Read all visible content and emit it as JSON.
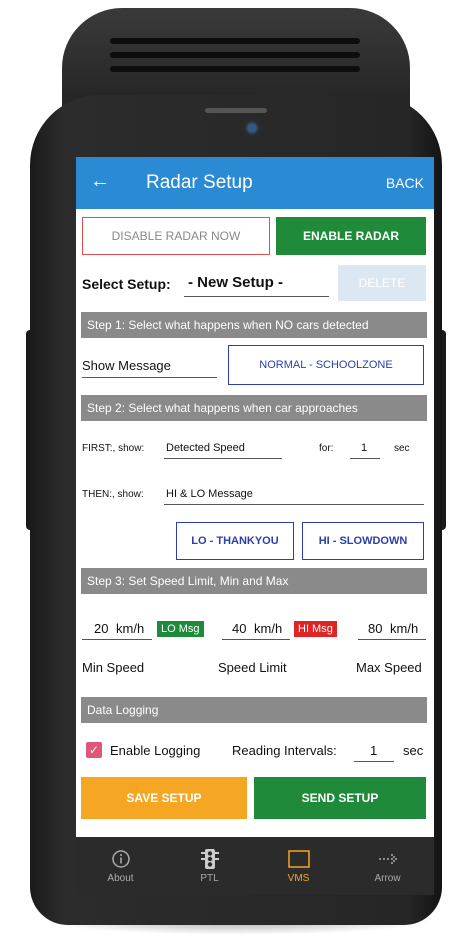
{
  "appbar": {
    "title": "Radar Setup",
    "back_label": "BACK"
  },
  "radar_buttons": {
    "disable_label": "DISABLE RADAR NOW",
    "enable_label": "ENABLE RADAR"
  },
  "setup": {
    "select_label": "Select Setup:",
    "value": "- New Setup -",
    "delete_label": "DELETE"
  },
  "step1": {
    "header": "Step 1: Select what happens when NO cars detected",
    "action_value": "Show Message",
    "message_button": "NORMAL - SCHOOLZONE"
  },
  "step2": {
    "header": "Step 2: Select what happens when car approaches",
    "first_label": "FIRST:, show:",
    "first_value": "Detected Speed",
    "for_label": "for:",
    "for_value": "1",
    "sec_label": "sec",
    "then_label": "THEN:, show:",
    "then_value": "HI & LO Message",
    "lo_button": "LO - THANKYOU",
    "hi_button": "HI - SLOWDOWN"
  },
  "step3": {
    "header": "Step 3: Set Speed Limit, Min and Max",
    "min_value": "20",
    "limit_value": "40",
    "max_value": "80",
    "unit": "km/h",
    "lo_msg_badge": "LO Msg",
    "hi_msg_badge": "HI Msg",
    "min_label": "Min Speed",
    "limit_label": "Speed Limit",
    "max_label": "Max Speed"
  },
  "logging": {
    "header": "Data Logging",
    "enable_label": "Enable Logging",
    "enabled": true,
    "interval_label": "Reading Intervals:",
    "interval_value": "1",
    "interval_unit": "sec"
  },
  "actions": {
    "save_label": "SAVE SETUP",
    "send_label": "SEND SETUP"
  },
  "nav": {
    "items": [
      {
        "label": "About",
        "icon": "info-icon",
        "active": false
      },
      {
        "label": "PTL",
        "icon": "traffic-light-icon",
        "active": false
      },
      {
        "label": "VMS",
        "icon": "sign-board-icon",
        "active": true
      },
      {
        "label": "Arrow",
        "icon": "arrow-board-icon",
        "active": false
      }
    ]
  },
  "colors": {
    "appbar": "#2a8ad4",
    "enable_green": "#1e8a3a",
    "save_orange": "#f5a623",
    "send_green": "#1e8a3a",
    "section_grey": "#8a8a8a",
    "outline_blue": "#2b3fa8",
    "lo_badge": "#1e8a3a",
    "hi_badge": "#e02424",
    "checkbox_pink": "#e0557a",
    "nav_active": "#f5a623"
  }
}
